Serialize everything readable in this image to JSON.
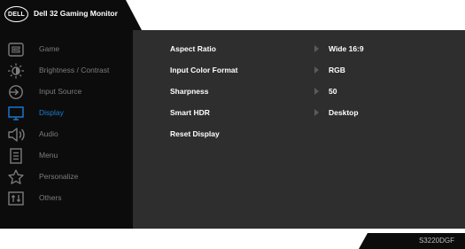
{
  "header": {
    "logo_text": "DELL",
    "title": "Dell 32 Gaming Monitor"
  },
  "menu": {
    "items": [
      {
        "label": "Game",
        "icon": "game-icon",
        "active": false
      },
      {
        "label": "Brightness / Contrast",
        "icon": "brightness-icon",
        "active": false
      },
      {
        "label": "Input Source",
        "icon": "input-source-icon",
        "active": false
      },
      {
        "label": "Display",
        "icon": "display-icon",
        "active": true
      },
      {
        "label": "Audio",
        "icon": "audio-icon",
        "active": false
      },
      {
        "label": "Menu",
        "icon": "menu-icon",
        "active": false
      },
      {
        "label": "Personalize",
        "icon": "star-icon",
        "active": false
      },
      {
        "label": "Others",
        "icon": "others-icon",
        "active": false
      }
    ]
  },
  "settings": {
    "rows": [
      {
        "label": "Aspect Ratio",
        "value": "Wide 16:9"
      },
      {
        "label": "Input Color Format",
        "value": "RGB"
      },
      {
        "label": "Sharpness",
        "value": "50"
      },
      {
        "label": "Smart HDR",
        "value": "Desktop"
      },
      {
        "label": "Reset Display",
        "value": ""
      }
    ]
  },
  "footer": {
    "model": "S3220DGF"
  },
  "colors": {
    "active": "#1c7cd5",
    "inactive": "#7c7c7c",
    "panel_right": "#2e2e2e",
    "panel_left": "#0c0c0c"
  }
}
